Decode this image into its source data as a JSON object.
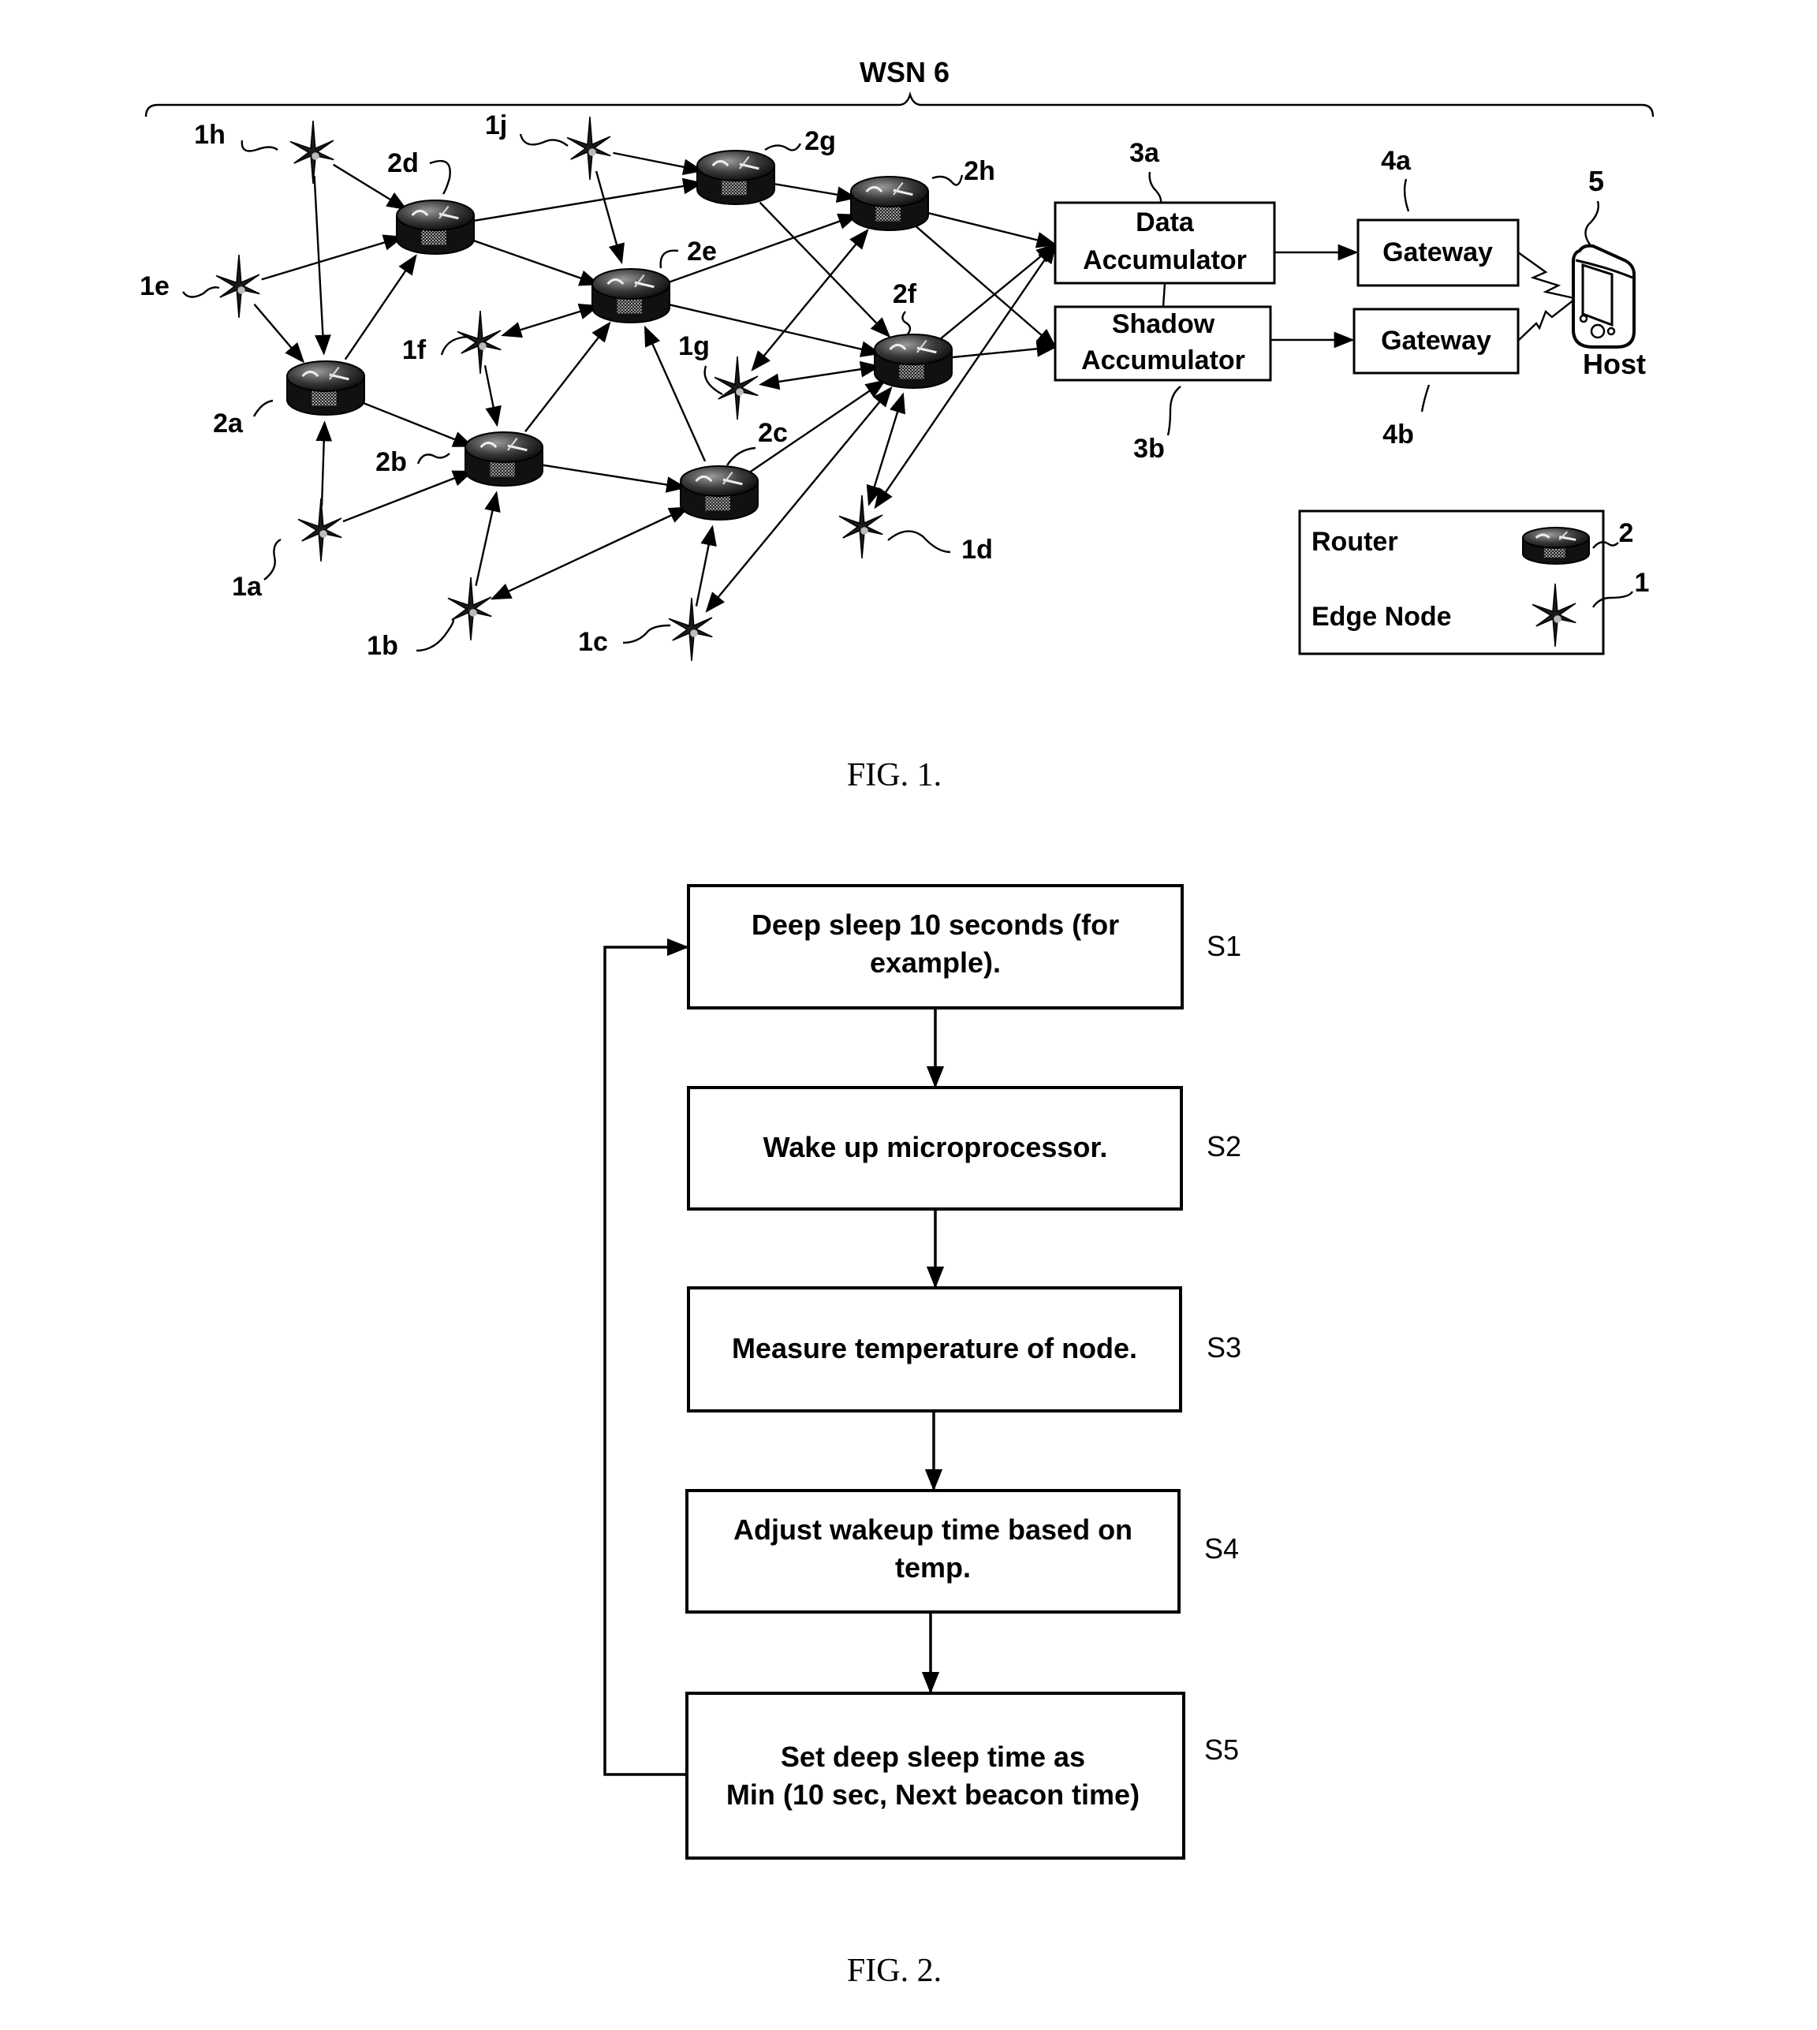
{
  "figure1": {
    "caption": "FIG. 1.",
    "network_label": "WSN 6",
    "edge_nodes": [
      {
        "id": "1a",
        "label": "1a"
      },
      {
        "id": "1b",
        "label": "1b"
      },
      {
        "id": "1c",
        "label": "1c"
      },
      {
        "id": "1d",
        "label": "1d"
      },
      {
        "id": "1e",
        "label": "1e"
      },
      {
        "id": "1f",
        "label": "1f"
      },
      {
        "id": "1g",
        "label": "1g"
      },
      {
        "id": "1h",
        "label": "1h"
      },
      {
        "id": "1j",
        "label": "1j"
      }
    ],
    "routers": [
      {
        "id": "2a",
        "label": "2a"
      },
      {
        "id": "2b",
        "label": "2b"
      },
      {
        "id": "2c",
        "label": "2c"
      },
      {
        "id": "2d",
        "label": "2d"
      },
      {
        "id": "2e",
        "label": "2e"
      },
      {
        "id": "2f",
        "label": "2f"
      },
      {
        "id": "2g",
        "label": "2g"
      },
      {
        "id": "2h",
        "label": "2h"
      }
    ],
    "data_accumulator": {
      "ref": "3a",
      "line1": "Data",
      "line2": "Accumulator"
    },
    "shadow_accumulator": {
      "ref": "3b",
      "line1": "Shadow",
      "line2": "Accumulator"
    },
    "gateway_a": {
      "ref": "4a",
      "label": "Gateway"
    },
    "gateway_b": {
      "ref": "4b",
      "label": "Gateway"
    },
    "host": {
      "ref": "5",
      "label": "Host",
      "icon": "handheld-device-icon"
    },
    "legend": {
      "router_label": "Router",
      "router_ref": "2",
      "edge_node_label": "Edge Node",
      "edge_node_ref": "1"
    },
    "links": [
      [
        "1h",
        "2d",
        "to"
      ],
      [
        "1h",
        "2a",
        "to"
      ],
      [
        "1e",
        "2d",
        "to"
      ],
      [
        "1e",
        "2a",
        "to"
      ],
      [
        "2a",
        "2d",
        "to"
      ],
      [
        "2a",
        "2b",
        "to"
      ],
      [
        "1a",
        "2a",
        "to"
      ],
      [
        "1a",
        "2b",
        "to"
      ],
      [
        "1f",
        "2e",
        "both"
      ],
      [
        "1f",
        "2b",
        "to"
      ],
      [
        "1b",
        "2b",
        "to"
      ],
      [
        "1b",
        "2c",
        "both"
      ],
      [
        "2b",
        "2e",
        "to"
      ],
      [
        "2b",
        "2c",
        "to"
      ],
      [
        "2c",
        "2e",
        "to"
      ],
      [
        "2c",
        "2f",
        "to"
      ],
      [
        "1c",
        "2c",
        "to"
      ],
      [
        "1c",
        "2f",
        "both"
      ],
      [
        "2d",
        "2g",
        "to"
      ],
      [
        "2d",
        "2e",
        "to"
      ],
      [
        "1j",
        "2g",
        "to"
      ],
      [
        "1j",
        "2e",
        "to"
      ],
      [
        "2g",
        "2h",
        "to"
      ],
      [
        "2g",
        "2f",
        "to"
      ],
      [
        "2e",
        "2h",
        "to"
      ],
      [
        "2e",
        "2f",
        "to"
      ],
      [
        "1g",
        "2f",
        "both"
      ],
      [
        "1g",
        "2h",
        "both"
      ],
      [
        "1d",
        "2f",
        "both"
      ],
      [
        "1d",
        "DA",
        "both"
      ],
      [
        "2h",
        "DA",
        "to"
      ],
      [
        "2h",
        "SA",
        "to"
      ],
      [
        "2f",
        "DA",
        "to"
      ],
      [
        "2f",
        "SA",
        "to"
      ],
      [
        "DA",
        "GA",
        "to"
      ],
      [
        "SA",
        "GB",
        "to"
      ]
    ]
  },
  "figure2": {
    "caption": "FIG. 2.",
    "steps": [
      {
        "id": "S1",
        "line1": "Deep sleep 10 seconds (for",
        "line2": "example)."
      },
      {
        "id": "S2",
        "line1": "Wake up microprocessor.",
        "line2": ""
      },
      {
        "id": "S3",
        "line1": "Measure temperature of node.",
        "line2": ""
      },
      {
        "id": "S4",
        "line1": "Adjust wakeup time based on",
        "line2": "temp."
      },
      {
        "id": "S5",
        "line1": "Set deep sleep time as",
        "line2": "Min (10 sec, Next beacon time)"
      }
    ],
    "loop": {
      "from": "S5",
      "to": "S1"
    }
  }
}
